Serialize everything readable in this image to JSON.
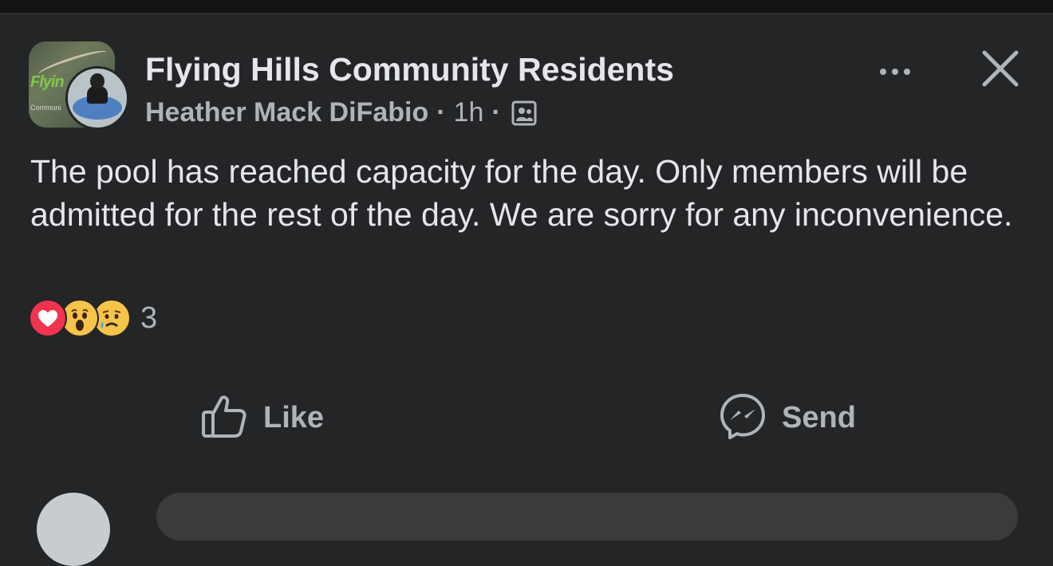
{
  "group": {
    "name": "Flying Hills Community Residents",
    "avatar_logo_text": "Flyin",
    "avatar_caption": "Communi"
  },
  "post": {
    "author": "Heather Mack DiFabio",
    "separator": "·",
    "time": "1h",
    "visibility_icon": "members-icon",
    "text": "The pool has reached capacity for the day. Only members will be admitted for the rest of the day. We are sorry for any inconvenience."
  },
  "reactions": {
    "types": [
      "love",
      "wow",
      "sad"
    ],
    "count": "3"
  },
  "actions": {
    "like_label": "Like",
    "send_label": "Send"
  },
  "colors": {
    "background": "#242526",
    "primary_text": "#e4e6eb",
    "secondary_text": "#b0b3b8",
    "love": "#f0344f",
    "emoji_yellow": "#f7c44a"
  }
}
